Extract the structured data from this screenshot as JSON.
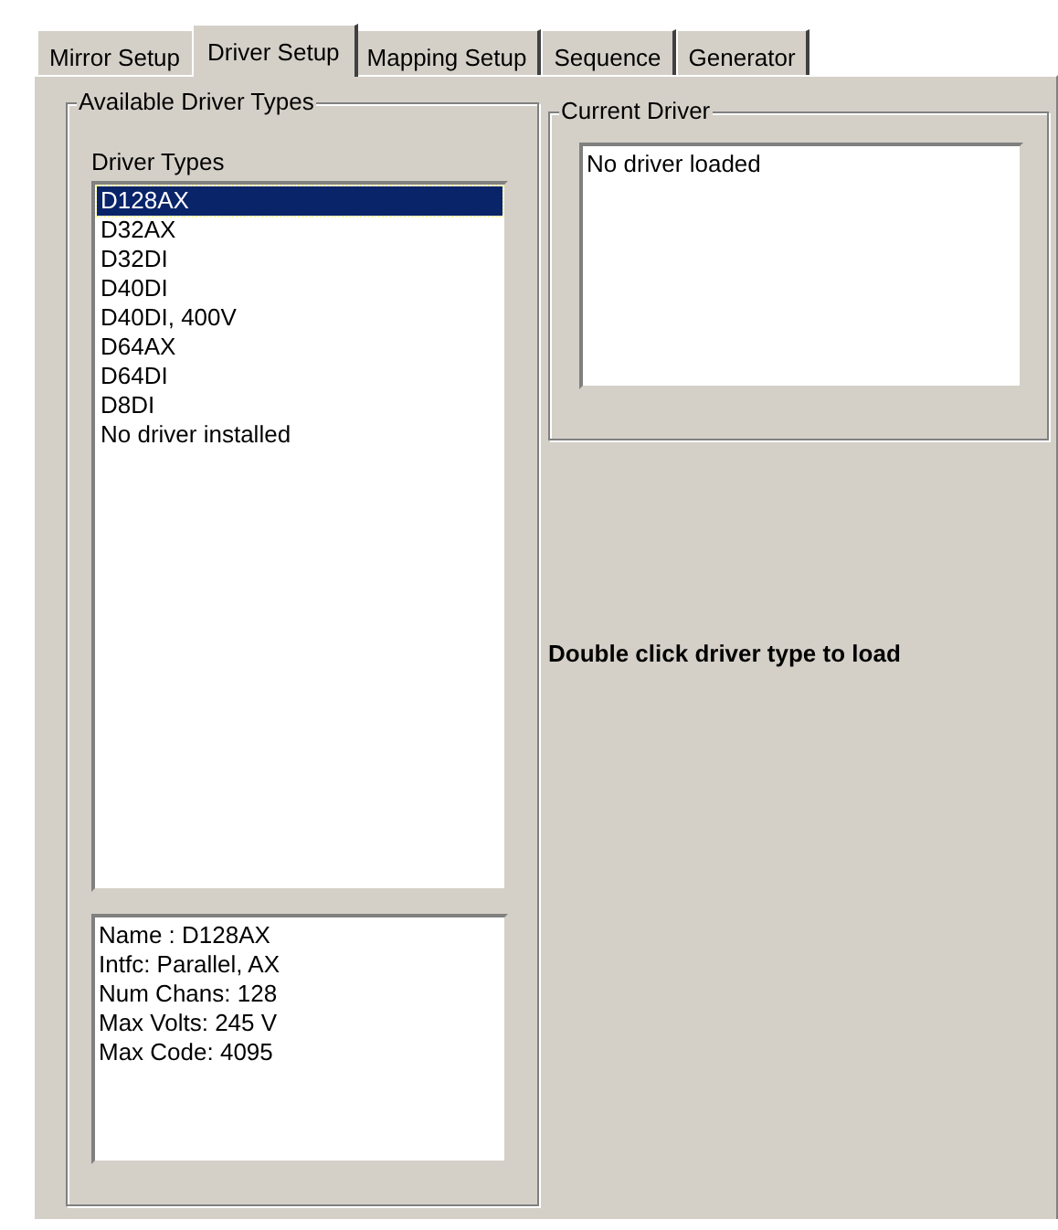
{
  "tabs": [
    {
      "label": "Mirror Setup",
      "selected": false
    },
    {
      "label": "Driver Setup",
      "selected": true
    },
    {
      "label": "Mapping Setup",
      "selected": false
    },
    {
      "label": "Sequence",
      "selected": false
    },
    {
      "label": "Generator",
      "selected": false
    }
  ],
  "available_driver_types": {
    "title": "Available Driver Types",
    "list_label": "Driver Types",
    "items": [
      {
        "label": "D128AX",
        "selected": true
      },
      {
        "label": "D32AX",
        "selected": false
      },
      {
        "label": "D32DI",
        "selected": false
      },
      {
        "label": "D40DI",
        "selected": false
      },
      {
        "label": "D40DI, 400V",
        "selected": false
      },
      {
        "label": "D64AX",
        "selected": false
      },
      {
        "label": "D64DI",
        "selected": false
      },
      {
        "label": "D8DI",
        "selected": false
      },
      {
        "label": "No driver installed",
        "selected": false
      }
    ],
    "info_lines": [
      "Name : D128AX",
      "Intfc: Parallel, AX",
      "Num Chans: 128",
      "Max Volts: 245 V",
      "Max Code: 4095"
    ]
  },
  "current_driver": {
    "title": "Current Driver",
    "text": "No driver loaded"
  },
  "hint": "Double click driver type to load"
}
